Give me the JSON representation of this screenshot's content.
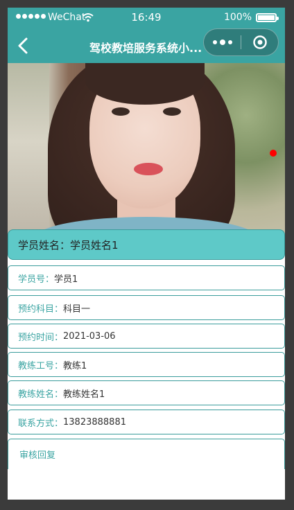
{
  "status_bar": {
    "carrier": "WeChat",
    "time": "16:49",
    "battery": "100%"
  },
  "nav": {
    "title": "驾校教培服务系统小...",
    "back_icon": "chevron-left-icon",
    "more_icon": "more-dots-icon",
    "close_icon": "target-circle-icon"
  },
  "profile": {
    "photo": "student-photo",
    "name_label": "学员姓名：",
    "name_value": "学员姓名1"
  },
  "fields": [
    {
      "label": "学员号：",
      "value": "学员1"
    },
    {
      "label": "预约科目：",
      "value": "科目一"
    },
    {
      "label": "预约时间：",
      "value": "2021-03-06"
    },
    {
      "label": "教练工号：",
      "value": "教练1"
    },
    {
      "label": "教练姓名：",
      "value": "教练姓名1"
    },
    {
      "label": "联系方式：",
      "value": "13823888881"
    }
  ],
  "reply": {
    "label": "审核回复"
  },
  "colors": {
    "primary": "#3aa4a2",
    "name_bar": "#5ec9c8",
    "background": "#3b3b3b"
  }
}
